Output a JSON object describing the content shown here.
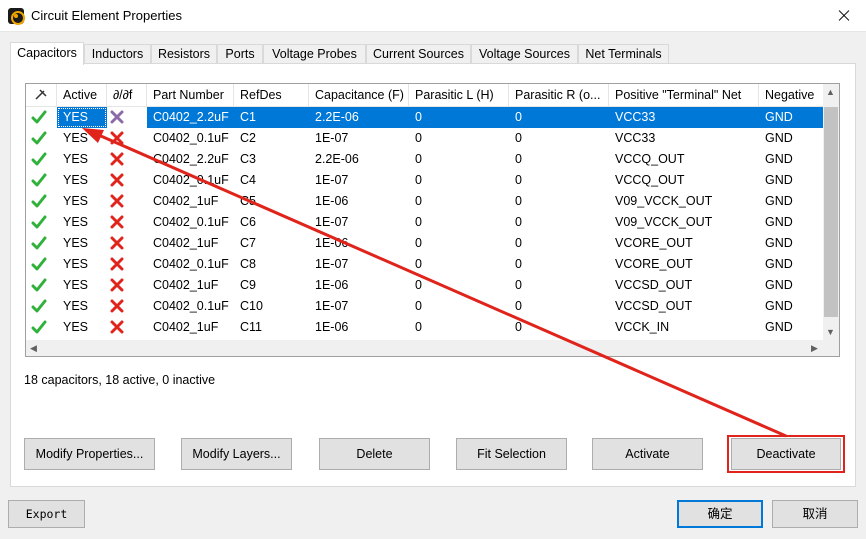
{
  "window": {
    "title": "Circuit Element Properties"
  },
  "tabs": [
    "Capacitors",
    "Inductors",
    "Resistors",
    "Ports",
    "Voltage Probes",
    "Current Sources",
    "Voltage Sources",
    "Net Terminals"
  ],
  "table": {
    "columns": [
      "Active",
      "∂/∂f",
      "Part Number",
      "RefDes",
      "Capacitance (F)",
      "Parasitic L (H)",
      "Parasitic R (o...",
      "Positive \"Terminal\" Net",
      "Negative"
    ],
    "rows": [
      [
        "YES",
        "C0402_2.2uF",
        "C1",
        "2.2E-06",
        "0",
        "0",
        "VCC33",
        "GND"
      ],
      [
        "YES",
        "C0402_0.1uF",
        "C2",
        "1E-07",
        "0",
        "0",
        "VCC33",
        "GND"
      ],
      [
        "YES",
        "C0402_2.2uF",
        "C3",
        "2.2E-06",
        "0",
        "0",
        "VCCQ_OUT",
        "GND"
      ],
      [
        "YES",
        "C0402_0.1uF",
        "C4",
        "1E-07",
        "0",
        "0",
        "VCCQ_OUT",
        "GND"
      ],
      [
        "YES",
        "C0402_1uF",
        "C5",
        "1E-06",
        "0",
        "0",
        "V09_VCCK_OUT",
        "GND"
      ],
      [
        "YES",
        "C0402_0.1uF",
        "C6",
        "1E-07",
        "0",
        "0",
        "V09_VCCK_OUT",
        "GND"
      ],
      [
        "YES",
        "C0402_1uF",
        "C7",
        "1E-06",
        "0",
        "0",
        "VCORE_OUT",
        "GND"
      ],
      [
        "YES",
        "C0402_0.1uF",
        "C8",
        "1E-07",
        "0",
        "0",
        "VCORE_OUT",
        "GND"
      ],
      [
        "YES",
        "C0402_1uF",
        "C9",
        "1E-06",
        "0",
        "0",
        "VCCSD_OUT",
        "GND"
      ],
      [
        "YES",
        "C0402_0.1uF",
        "C10",
        "1E-07",
        "0",
        "0",
        "VCCSD_OUT",
        "GND"
      ],
      [
        "YES",
        "C0402_1uF",
        "C11",
        "1E-06",
        "0",
        "0",
        "VCCK_IN",
        "GND"
      ]
    ]
  },
  "status": "18 capacitors, 18 active, 0 inactive",
  "buttons": {
    "modify_properties": "Modify Properties...",
    "modify_layers": "Modify Layers...",
    "delete": "Delete",
    "fit_selection": "Fit Selection",
    "activate": "Activate",
    "deactivate": "Deactivate"
  },
  "footer": {
    "export": "Export",
    "ok": "确定",
    "cancel": "取消"
  },
  "icons": {
    "check": "check-icon",
    "x_mark": "x-mark-icon",
    "pin": "pin-icon"
  },
  "colors": {
    "selection": "#0078d7",
    "annotation": "#e0241b",
    "check": "#2fb13a",
    "x_mark": "#e0241b"
  }
}
